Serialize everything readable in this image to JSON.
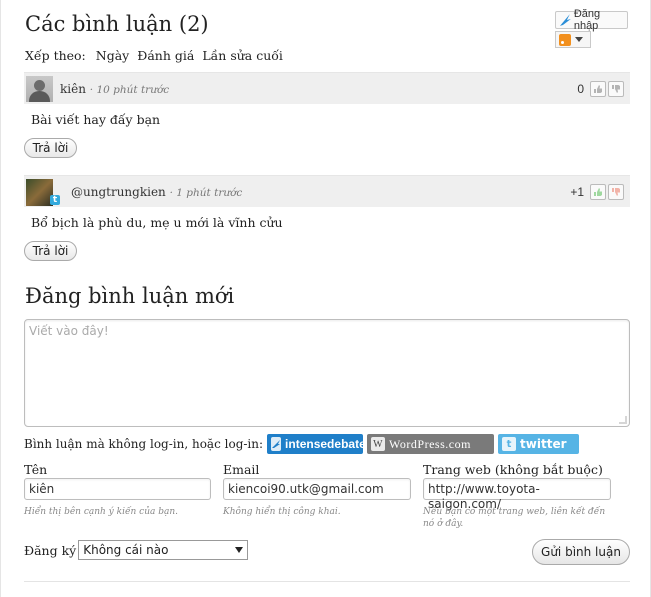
{
  "header": {
    "title": "Các bình luận (2)",
    "login_label": "Đăng nhập"
  },
  "sort": {
    "label": "Xếp theo:",
    "options": [
      "Ngày",
      "Đánh giá",
      "Lần sửa cuối"
    ]
  },
  "comments": [
    {
      "author": "kiên",
      "time": "· 10 phút trước",
      "score": "0",
      "text": "Bài viết hay đấy bạn",
      "reply_label": "Trả lời"
    },
    {
      "author": "@ungtrungkien",
      "time": "· 1 phút trước",
      "score": "+1",
      "text": "Bổ bịch là phù du, mẹ u mới là vĩnh cửu",
      "reply_label": "Trả lời"
    }
  ],
  "new_comment": {
    "title": "Đăng bình luận mới",
    "placeholder": "Viết vào đây!",
    "login_prompt": "Bình luận mà không log-in, hoặc log-in:",
    "services": [
      "intensedebate",
      "WordPress.com",
      "twitter"
    ]
  },
  "fields": {
    "name": {
      "label": "Tên",
      "value": "kiên",
      "hint": "Hiển thị bên cạnh ý kiến của bạn."
    },
    "email": {
      "label": "Email",
      "value": "kiencoi90.utk@gmail.com",
      "hint": "Không hiển thị công khai."
    },
    "website": {
      "label": "Trang web (không bắt buộc)",
      "value": "http://www.toyota-saigon.com/",
      "hint": "Nếu bạn có một trang web, liên kết đến nó ở đây."
    }
  },
  "subscribe": {
    "label": "Đăng ký",
    "selected": "Không cái nào"
  },
  "submit_label": "Gửi bình luận",
  "colors": {
    "intensedebate": "#1f7fc9",
    "wordpress": "#7a7a7a",
    "twitter": "#56b4e5",
    "rss": "#f2901e"
  }
}
